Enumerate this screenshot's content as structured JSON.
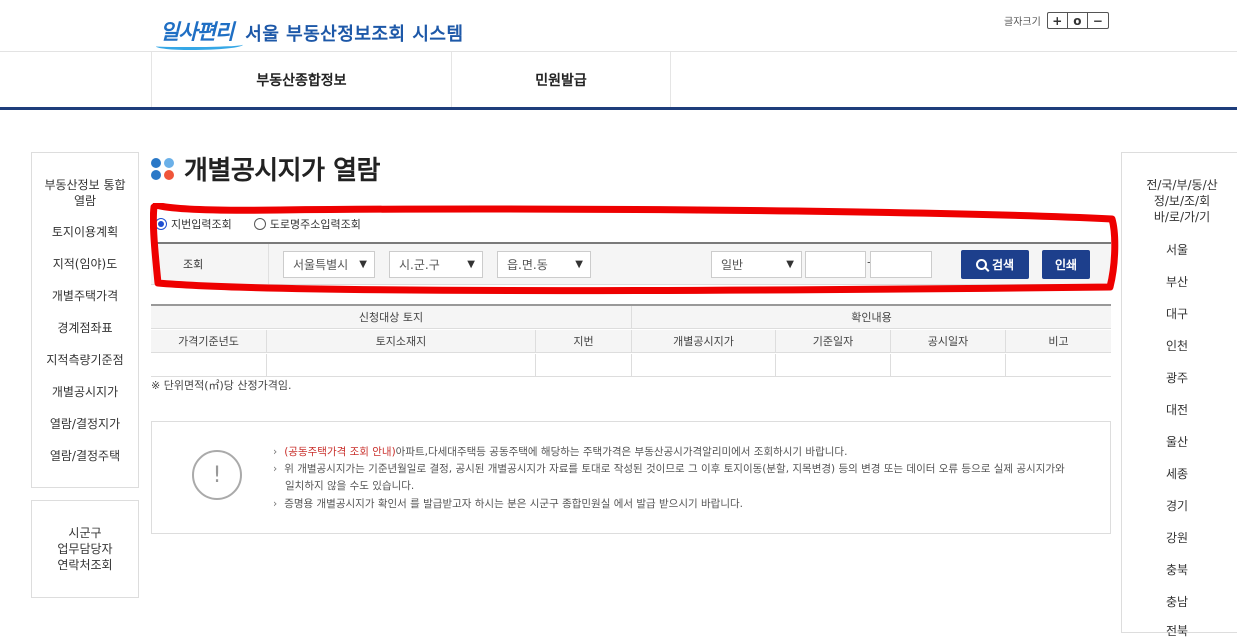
{
  "header": {
    "logo_mark": "일사편리",
    "logo_text": "서울 부동산정보조회 시스템",
    "font_size_label": "글자크기",
    "font_size_buttons": [
      "+",
      "o",
      "−"
    ]
  },
  "nav": {
    "items": [
      "부동산종합정보",
      "민원발급"
    ]
  },
  "left_sidebar": {
    "items": [
      "부동산정보 통합\n열람",
      "토지이용계획",
      "지적(임야)도",
      "개별주택가격",
      "경계점좌표",
      "지적측량기준점",
      "개별공시지가",
      "열람/결정지가",
      "열람/결정주택"
    ],
    "contact": "시군구\n업무담당자\n연락처조회"
  },
  "right_sidebar": {
    "title": "전/국/부/동/산\n정/보/조/회\n바/로/가/기",
    "items": [
      "서울",
      "부산",
      "대구",
      "인천",
      "광주",
      "대전",
      "울산",
      "세종",
      "경기",
      "강원",
      "충북",
      "충남",
      "전북"
    ]
  },
  "page": {
    "title": "개별공시지가 열람",
    "dot_colors": [
      "#2a78c7",
      "#6bb0e8",
      "#2a78c7",
      "#f0553a"
    ]
  },
  "search": {
    "radio_options": [
      "지번입력조회",
      "도로명주소입력조회"
    ],
    "selected_radio": "지번입력조회",
    "label": "조회",
    "city": "서울특별시",
    "district": "시.군.구",
    "town": "읍.면.동",
    "land_type": "일반",
    "main_number": "",
    "sub_number": "",
    "dash": "-",
    "search_button": "검색",
    "print_button": "인쇄"
  },
  "annotation": {
    "color": "#ee0000"
  },
  "table": {
    "group_headers": [
      "신청대상 토지",
      "확인내용"
    ],
    "columns": [
      "가격기준년도",
      "토지소재지",
      "지번",
      "개별공시지가",
      "기준일자",
      "공시일자",
      "비고"
    ],
    "rows": []
  },
  "note": "※ 단위면적(㎡)당 산정가격임.",
  "info": {
    "line1_link": "(공동주택가격 조회 안내)",
    "line1_rest": "아파트,다세대주택등 공동주택에 해당하는 주택가격은 부동산공시가격알리미에서 조회하시기 바랍니다.",
    "line2": "위 개별공시지가는 기준년월일로 결정, 공시된 개별공시지가 자료를 토대로 작성된 것이므로 그 이후 토지이동(분할, 지목변경) 등의 변경 또는 데이터 오류 등으로 실제 공시지가와",
    "line2_cont": "일치하지 않을 수도 있습니다.",
    "line3": "증명용 개별공시지가 확인서 를 발급받고자 하시는 분은 시군구 종합민원실 에서 발급 받으시기 바랍니다.",
    "icon_text": "!"
  }
}
